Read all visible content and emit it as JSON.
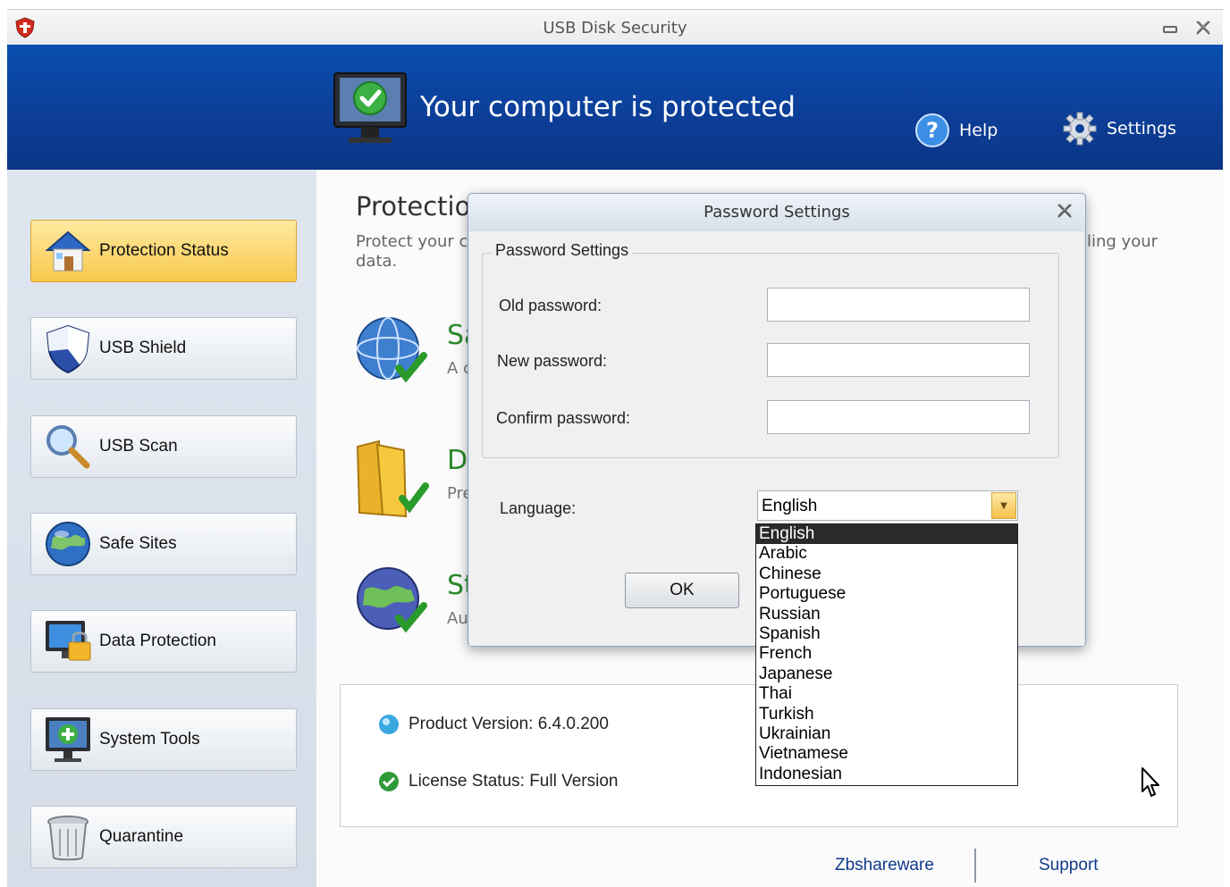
{
  "window": {
    "title": "USB Disk Security",
    "minimize_label": "",
    "close_label": ""
  },
  "banner": {
    "headline": "Your computer is protected",
    "help_label": "Help",
    "settings_label": "Settings"
  },
  "sidebar": {
    "items": [
      {
        "label": "Protection Status",
        "icon": "house-icon",
        "active": true
      },
      {
        "label": "USB Shield",
        "icon": "shield-icon",
        "active": false
      },
      {
        "label": "USB Scan",
        "icon": "magnifier-icon",
        "active": false
      },
      {
        "label": "Safe Sites",
        "icon": "globe-icon",
        "active": false
      },
      {
        "label": "Data Protection",
        "icon": "lock-monitor-icon",
        "active": false
      },
      {
        "label": "System Tools",
        "icon": "monitor-tools-icon",
        "active": false
      },
      {
        "label": "Quarantine",
        "icon": "trash-can-icon",
        "active": false
      }
    ]
  },
  "main": {
    "title_visible": "Protectio",
    "desc_line1": "Protect your co",
    "desc_line2": "data.",
    "desc_right": "ling your",
    "features": [
      {
        "title": "Sa",
        "sub": "A c",
        "icon": "globe-check-icon"
      },
      {
        "title": "D",
        "sub": "Pre",
        "icon": "folder-check-icon"
      },
      {
        "title": "St",
        "sub": "Au",
        "icon": "earth-check-icon"
      }
    ],
    "product_version": "Product Version: 6.4.0.200",
    "license_status": "License Status: Full Version",
    "footer": {
      "link1": "Zbshareware",
      "link2": "Support"
    }
  },
  "dialog": {
    "title": "Password Settings",
    "group_label": "Password Settings",
    "old_password_label": "Old password:",
    "new_password_label": "New password:",
    "confirm_password_label": "Confirm password:",
    "old_password_value": "",
    "new_password_value": "",
    "confirm_password_value": "",
    "language_label": "Language:",
    "language_selected": "English",
    "ok_label": "OK"
  },
  "language_options": [
    "English",
    "Arabic",
    "Chinese",
    "Portuguese",
    "Russian",
    "Spanish",
    "French",
    "Japanese",
    "Thai",
    "Turkish",
    "Ukrainian",
    "Vietnamese",
    "Indonesian"
  ],
  "colors": {
    "banner": "#0c3f98",
    "active_nav": "#f7c94b",
    "accent_green": "#2a8a2a"
  }
}
